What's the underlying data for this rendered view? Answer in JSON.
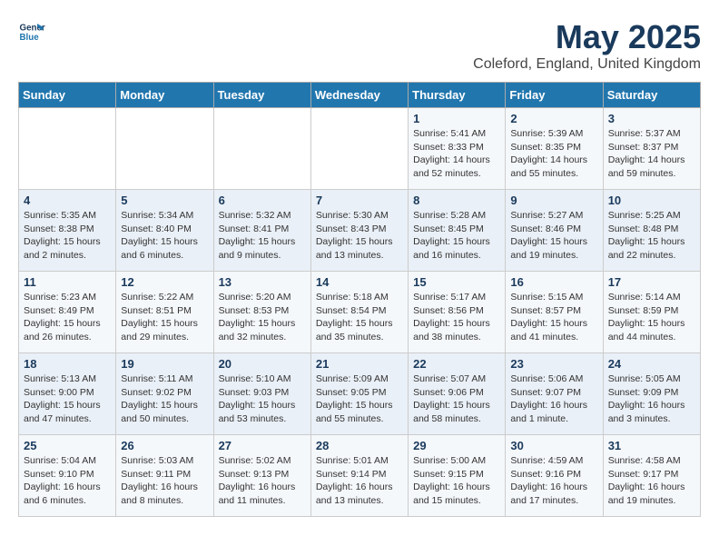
{
  "header": {
    "logo_line1": "General",
    "logo_line2": "Blue",
    "title": "May 2025",
    "subtitle": "Coleford, England, United Kingdom"
  },
  "weekdays": [
    "Sunday",
    "Monday",
    "Tuesday",
    "Wednesday",
    "Thursday",
    "Friday",
    "Saturday"
  ],
  "weeks": [
    [
      {
        "day": "",
        "info": ""
      },
      {
        "day": "",
        "info": ""
      },
      {
        "day": "",
        "info": ""
      },
      {
        "day": "",
        "info": ""
      },
      {
        "day": "1",
        "info": "Sunrise: 5:41 AM\nSunset: 8:33 PM\nDaylight: 14 hours\nand 52 minutes."
      },
      {
        "day": "2",
        "info": "Sunrise: 5:39 AM\nSunset: 8:35 PM\nDaylight: 14 hours\nand 55 minutes."
      },
      {
        "day": "3",
        "info": "Sunrise: 5:37 AM\nSunset: 8:37 PM\nDaylight: 14 hours\nand 59 minutes."
      }
    ],
    [
      {
        "day": "4",
        "info": "Sunrise: 5:35 AM\nSunset: 8:38 PM\nDaylight: 15 hours\nand 2 minutes."
      },
      {
        "day": "5",
        "info": "Sunrise: 5:34 AM\nSunset: 8:40 PM\nDaylight: 15 hours\nand 6 minutes."
      },
      {
        "day": "6",
        "info": "Sunrise: 5:32 AM\nSunset: 8:41 PM\nDaylight: 15 hours\nand 9 minutes."
      },
      {
        "day": "7",
        "info": "Sunrise: 5:30 AM\nSunset: 8:43 PM\nDaylight: 15 hours\nand 13 minutes."
      },
      {
        "day": "8",
        "info": "Sunrise: 5:28 AM\nSunset: 8:45 PM\nDaylight: 15 hours\nand 16 minutes."
      },
      {
        "day": "9",
        "info": "Sunrise: 5:27 AM\nSunset: 8:46 PM\nDaylight: 15 hours\nand 19 minutes."
      },
      {
        "day": "10",
        "info": "Sunrise: 5:25 AM\nSunset: 8:48 PM\nDaylight: 15 hours\nand 22 minutes."
      }
    ],
    [
      {
        "day": "11",
        "info": "Sunrise: 5:23 AM\nSunset: 8:49 PM\nDaylight: 15 hours\nand 26 minutes."
      },
      {
        "day": "12",
        "info": "Sunrise: 5:22 AM\nSunset: 8:51 PM\nDaylight: 15 hours\nand 29 minutes."
      },
      {
        "day": "13",
        "info": "Sunrise: 5:20 AM\nSunset: 8:53 PM\nDaylight: 15 hours\nand 32 minutes."
      },
      {
        "day": "14",
        "info": "Sunrise: 5:18 AM\nSunset: 8:54 PM\nDaylight: 15 hours\nand 35 minutes."
      },
      {
        "day": "15",
        "info": "Sunrise: 5:17 AM\nSunset: 8:56 PM\nDaylight: 15 hours\nand 38 minutes."
      },
      {
        "day": "16",
        "info": "Sunrise: 5:15 AM\nSunset: 8:57 PM\nDaylight: 15 hours\nand 41 minutes."
      },
      {
        "day": "17",
        "info": "Sunrise: 5:14 AM\nSunset: 8:59 PM\nDaylight: 15 hours\nand 44 minutes."
      }
    ],
    [
      {
        "day": "18",
        "info": "Sunrise: 5:13 AM\nSunset: 9:00 PM\nDaylight: 15 hours\nand 47 minutes."
      },
      {
        "day": "19",
        "info": "Sunrise: 5:11 AM\nSunset: 9:02 PM\nDaylight: 15 hours\nand 50 minutes."
      },
      {
        "day": "20",
        "info": "Sunrise: 5:10 AM\nSunset: 9:03 PM\nDaylight: 15 hours\nand 53 minutes."
      },
      {
        "day": "21",
        "info": "Sunrise: 5:09 AM\nSunset: 9:05 PM\nDaylight: 15 hours\nand 55 minutes."
      },
      {
        "day": "22",
        "info": "Sunrise: 5:07 AM\nSunset: 9:06 PM\nDaylight: 15 hours\nand 58 minutes."
      },
      {
        "day": "23",
        "info": "Sunrise: 5:06 AM\nSunset: 9:07 PM\nDaylight: 16 hours\nand 1 minute."
      },
      {
        "day": "24",
        "info": "Sunrise: 5:05 AM\nSunset: 9:09 PM\nDaylight: 16 hours\nand 3 minutes."
      }
    ],
    [
      {
        "day": "25",
        "info": "Sunrise: 5:04 AM\nSunset: 9:10 PM\nDaylight: 16 hours\nand 6 minutes."
      },
      {
        "day": "26",
        "info": "Sunrise: 5:03 AM\nSunset: 9:11 PM\nDaylight: 16 hours\nand 8 minutes."
      },
      {
        "day": "27",
        "info": "Sunrise: 5:02 AM\nSunset: 9:13 PM\nDaylight: 16 hours\nand 11 minutes."
      },
      {
        "day": "28",
        "info": "Sunrise: 5:01 AM\nSunset: 9:14 PM\nDaylight: 16 hours\nand 13 minutes."
      },
      {
        "day": "29",
        "info": "Sunrise: 5:00 AM\nSunset: 9:15 PM\nDaylight: 16 hours\nand 15 minutes."
      },
      {
        "day": "30",
        "info": "Sunrise: 4:59 AM\nSunset: 9:16 PM\nDaylight: 16 hours\nand 17 minutes."
      },
      {
        "day": "31",
        "info": "Sunrise: 4:58 AM\nSunset: 9:17 PM\nDaylight: 16 hours\nand 19 minutes."
      }
    ]
  ]
}
